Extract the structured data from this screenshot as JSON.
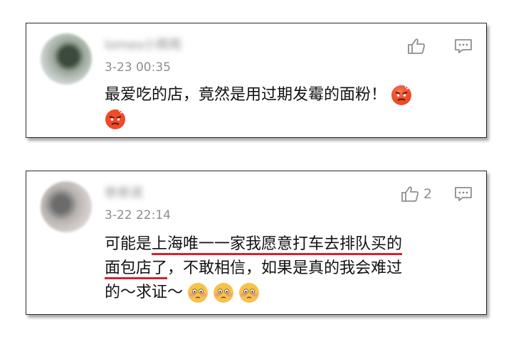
{
  "comments": [
    {
      "username": "lomes小雨雨",
      "time": "3-23 00:35",
      "like_count": "",
      "lines": [
        "最爱吃的店，竟然是用过期发霉的面粉！"
      ],
      "emojis": [
        "angry-emoji",
        "angry-emoji"
      ]
    },
    {
      "username": "依依说",
      "time": "3-22 22:14",
      "like_count": "2",
      "lines": [
        {
          "plain": "可能是",
          "underlined": "上海唯一一家我愿意打车去排队买的"
        },
        {
          "underlined": "面包店了",
          "plain": "，不敢相信，如果是真的我会难过"
        },
        {
          "plain": "的～求证～"
        }
      ],
      "emojis": [
        "flushed-emoji",
        "flushed-emoji",
        "flushed-emoji"
      ]
    }
  ],
  "colors": {
    "underline": "#d8202a",
    "meta": "#8e8e8e",
    "text": "#111111"
  }
}
